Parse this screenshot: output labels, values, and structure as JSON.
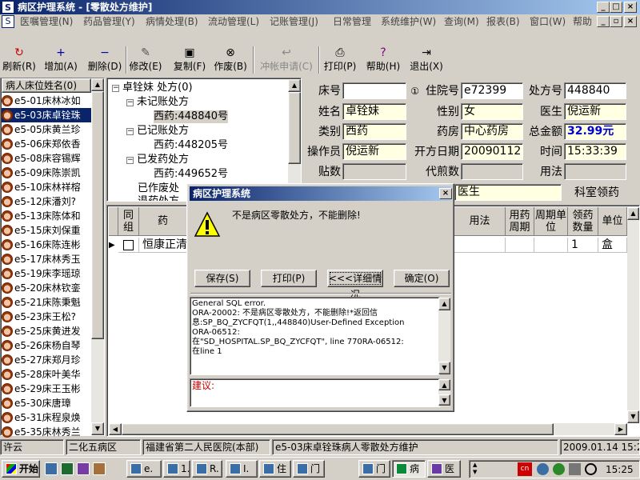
{
  "window": {
    "title": "病区护理系统 - [零散处方维护]"
  },
  "menu": [
    "医嘱管理(N)",
    "药品管理(Y)",
    "病情处理(B)",
    "流动管理(L)",
    "记账管理(J)",
    "日常管理",
    "系统维护(W)",
    "查询(M)",
    "报表(B)",
    "窗口(W)",
    "帮助"
  ],
  "toolbar": {
    "buttons": [
      {
        "label": "刷新(R)",
        "icon": "↻",
        "enabled": true
      },
      {
        "label": "增加(A)",
        "icon": "+",
        "enabled": true
      },
      {
        "label": "删除(D)",
        "icon": "−",
        "enabled": true
      },
      {
        "label": "修改(E)",
        "icon": "✎",
        "enabled": true
      },
      {
        "label": "复制(F)",
        "icon": "▣",
        "enabled": true
      },
      {
        "label": "作废(B)",
        "icon": "⊗",
        "enabled": true
      },
      {
        "label": "冲帐申请(C)",
        "icon": "↩",
        "enabled": false
      },
      {
        "label": "打印(P)",
        "icon": "⎙",
        "enabled": true
      },
      {
        "label": "帮助(H)",
        "icon": "?",
        "enabled": true
      },
      {
        "label": "退出(X)",
        "icon": "⇥",
        "enabled": true
      }
    ]
  },
  "patient_list": {
    "header": "病人床位姓名(0)",
    "items": [
      "e5-01床林冰如",
      "e5-03床卓铨珠",
      "e5-05床黄兰珍",
      "e5-06床郑依香",
      "e5-08床容锡辉",
      "e5-09床陈崇凯",
      "e5-10床林祥榕",
      "e5-12床潘刘?",
      "e5-13床陈体和",
      "e5-15床刘保重",
      "e5-16床陈连彬",
      "e5-17床林秀玉",
      "e5-19床李瑶琼",
      "e5-20床林钦銮",
      "e5-21床陈秉魁",
      "e5-23床王松?",
      "e5-25床黄进发",
      "e5-26床杨自琴",
      "e5-27床郑月珍",
      "e5-28床叶美华",
      "e5-29床王玉彬",
      "e5-30床唐璋",
      "e5-31床程泉焕",
      "e5-35床林秀兰"
    ],
    "selected_index": 1
  },
  "tree": {
    "root": "卓铨妹  处方(0)",
    "groups": [
      {
        "label": "未记账处方",
        "children": [
          "西药:448840号"
        ]
      },
      {
        "label": "已记账处方",
        "children": [
          "西药:448205号"
        ]
      },
      {
        "label": "已发药处方",
        "children": [
          "西药:449652号"
        ]
      },
      {
        "label": "已作废处",
        "children": []
      }
    ],
    "trailing": "退药处方"
  },
  "form": {
    "bed_no_label": "床号",
    "bed_no": "",
    "circle_one": "①",
    "admission_no_label": "住院号",
    "admission_no": "e72399",
    "rx_no_label": "处方号",
    "rx_no": "448840",
    "name_label": "姓名",
    "name": "卓铨妹",
    "sex_label": "性别",
    "sex": "女",
    "doctor_label": "医生",
    "doctor": "倪运新",
    "category_label": "类别",
    "category": "西药",
    "pharmacy_label": "药房",
    "pharmacy": "中心药房",
    "total_label": "总金额",
    "total": "32.99元",
    "operator_label": "操作员",
    "operator": "倪运新",
    "date_label": "开方日期",
    "date": "20090112",
    "time_label": "时间",
    "time": "15:33:39",
    "decoct_label": "贴数",
    "decoct": "",
    "proxy_decoct_label": "代煎数",
    "proxy_decoct": "",
    "usage_label": "用法",
    "usage": "",
    "partial_label": "医生",
    "dept_label": "科室领药"
  },
  "grid": {
    "headers": [
      "同组",
      "药",
      "用法",
      "用药周期",
      "周期单位",
      "领药数量",
      "单位"
    ],
    "row": {
      "group": "",
      "drug": "恒康正清",
      "qty": "1",
      "unit": "盒"
    }
  },
  "dialog": {
    "title": "病区护理系统",
    "message": "不是病区零散处方，不能删除!",
    "buttons": [
      "保存(S)",
      "打印(P)",
      "<<<详细情况",
      "确定(O)"
    ],
    "detail": "General SQL error.\nORA-20002: 不是病区零散处方，不能删除!*返回信\n息:SP_BQ_ZYCFQT(1,,448840)User-Defined Exception\nORA-06512:\n在\"SD_HOSPITAL.SP_BQ_ZYCFQT\", line 770RA-06512:\n在line 1",
    "suggestion_label": "建议:"
  },
  "status": [
    "许云",
    "二化五病区",
    "福建省第二人民医院(本部)",
    "e5-03床卓铨珠病人零散处方维护",
    "2009.01.14 15:25"
  ],
  "taskbar": {
    "start": "开始",
    "tasks": [
      "e.",
      "1.",
      "R.",
      "I.",
      "住",
      "门",
      "门",
      "病",
      "医"
    ],
    "clock": "15:25",
    "ime": "cn"
  },
  "colors": {
    "title": "#0a246a",
    "selection": "#0a246a",
    "total": "#0000cc"
  }
}
